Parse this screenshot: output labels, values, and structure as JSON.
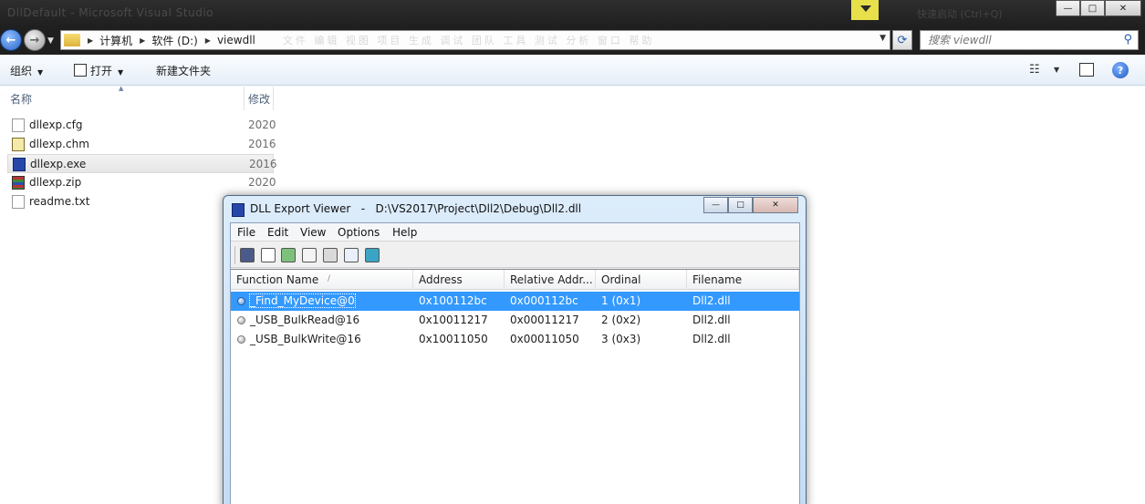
{
  "titlebar": {
    "ghost_text": "DllDefault - Microsoft Visual Studio",
    "ghost_right": "快速启动 (Ctrl+Q)",
    "minimize_glyph": "—",
    "maximize_glyph": "□",
    "close_glyph": "✕"
  },
  "address": {
    "crumbs": [
      "计算机",
      "软件 (D:)",
      "viewdll"
    ],
    "ghost_menu": "文件   编辑   视图   项目   生成   调试   团队   工具   测试   分析   窗口   帮助",
    "search_placeholder": "搜索 viewdll"
  },
  "commands": {
    "organize": "组织",
    "open": "打开",
    "new_folder": "新建文件夹"
  },
  "filelist": {
    "col_name": "名称",
    "col_modified": "修改",
    "files": [
      {
        "name": "dllexp.cfg",
        "date": "2020",
        "icon": "document-icon"
      },
      {
        "name": "dllexp.chm",
        "date": "2016",
        "icon": "help-file-icon"
      },
      {
        "name": "dllexp.exe",
        "date": "2016",
        "icon": "application-icon"
      },
      {
        "name": "dllexp.zip",
        "date": "2020",
        "icon": "archive-icon"
      },
      {
        "name": "readme.txt",
        "date": "",
        "icon": "text-file-icon"
      }
    ]
  },
  "dll_window": {
    "title": "DLL Export Viewer   -   D:\\VS2017\\Project\\Dll2\\Debug\\Dll2.dll",
    "menus": [
      "File",
      "Edit",
      "View",
      "Options",
      "Help"
    ],
    "columns": [
      "Function Name",
      "Address",
      "Relative Addr...",
      "Ordinal",
      "Filename"
    ],
    "sort_indicator": "/",
    "rows": [
      {
        "function": "_Find_MyDevice@0",
        "address": "0x100112bc",
        "relative": "0x000112bc",
        "ordinal": "1 (0x1)",
        "filename": "Dll2.dll"
      },
      {
        "function": "_USB_BulkRead@16",
        "address": "0x10011217",
        "relative": "0x00011217",
        "ordinal": "2 (0x2)",
        "filename": "Dll2.dll"
      },
      {
        "function": "_USB_BulkWrite@16",
        "address": "0x10011050",
        "relative": "0x00011050",
        "ordinal": "3 (0x3)",
        "filename": "Dll2.dll"
      }
    ]
  },
  "colors": {
    "selection": "#3399ff",
    "explorer_command_bar": "#e6eef8",
    "titlebar": "#1f1f1f"
  }
}
